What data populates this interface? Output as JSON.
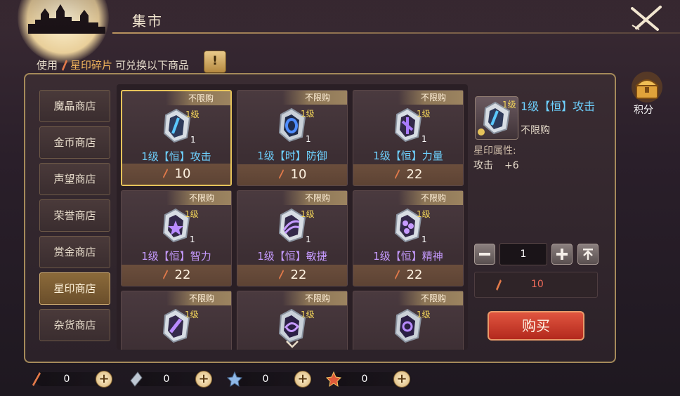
{
  "header": {
    "title": "集市"
  },
  "note": {
    "prefix": "使用",
    "currency": "星印碎片",
    "suffix": "可兑换以下商品",
    "info_label": "!"
  },
  "sidebar": {
    "items": [
      {
        "label": "魔晶商店",
        "active": false
      },
      {
        "label": "金币商店",
        "active": false
      },
      {
        "label": "声望商店",
        "active": false
      },
      {
        "label": "荣誉商店",
        "active": false
      },
      {
        "label": "赏金商店",
        "active": false
      },
      {
        "label": "星印商店",
        "active": true
      },
      {
        "label": "杂货商店",
        "active": false
      }
    ]
  },
  "shop": {
    "items": [
      {
        "tag": "不限购",
        "level": "1级",
        "count": "1",
        "name": "1级【恒】攻击",
        "price": "10",
        "color": "blue"
      },
      {
        "tag": "不限购",
        "level": "1级",
        "count": "1",
        "name": "1级【时】防御",
        "price": "10",
        "color": "blue"
      },
      {
        "tag": "不限购",
        "level": "1级",
        "count": "1",
        "name": "1级【恒】力量",
        "price": "22",
        "color": "blue"
      },
      {
        "tag": "不限购",
        "level": "1级",
        "count": "1",
        "name": "1级【恒】智力",
        "price": "22",
        "color": "purple"
      },
      {
        "tag": "不限购",
        "level": "1级",
        "count": "1",
        "name": "1级【恒】敏捷",
        "price": "22",
        "color": "purple"
      },
      {
        "tag": "不限购",
        "level": "1级",
        "count": "1",
        "name": "1级【恒】精神",
        "price": "22",
        "color": "purple"
      },
      {
        "tag": "不限购",
        "level": "1级",
        "count": "",
        "name": "",
        "price": "",
        "color": "purple"
      },
      {
        "tag": "不限购",
        "level": "1级",
        "count": "",
        "name": "",
        "price": "",
        "color": "purple"
      },
      {
        "tag": "不限购",
        "level": "1级",
        "count": "",
        "name": "",
        "price": "",
        "color": "purple"
      }
    ]
  },
  "detail": {
    "level_badge": "1级",
    "name": "1级【恒】攻击",
    "limit": "不限购",
    "attr_title": "星印属性:",
    "attr_name": "攻击",
    "attr_value": "+6",
    "quantity": "1",
    "total": "10",
    "buy_label": "购买"
  },
  "points": {
    "label": "积分"
  },
  "currencies": [
    {
      "icon": "star-fragment-icon",
      "value": "0"
    },
    {
      "icon": "crystal-shard-icon",
      "value": "0"
    },
    {
      "icon": "blue-star-icon",
      "value": "0"
    },
    {
      "icon": "red-star-icon",
      "value": "0"
    }
  ],
  "colors": {
    "accent_gold": "#e6c35a",
    "name_blue": "#6ed1ff",
    "name_purple": "#c69bff",
    "buy_red": "#c93a2a"
  }
}
